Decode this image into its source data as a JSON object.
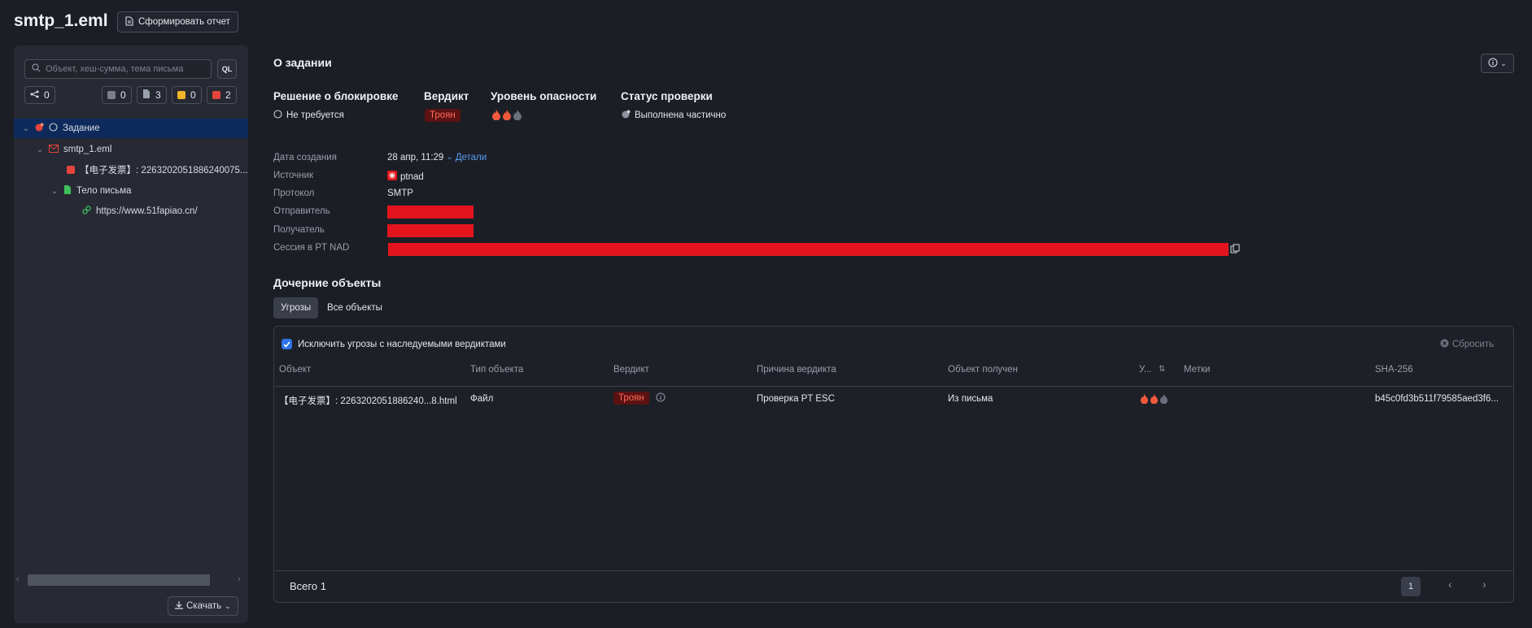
{
  "header": {
    "title": "smtp_1.eml",
    "report_button": "Сформировать отчет"
  },
  "sidebar": {
    "search_placeholder": "Объект, хеш-сумма, тема письма",
    "ql_label": "QL",
    "chips": [
      {
        "icon": "share-icon",
        "count": "0"
      },
      {
        "icon": "gray-square",
        "color": "#7a7f8c",
        "count": "0"
      },
      {
        "icon": "file-icon",
        "count": "3"
      },
      {
        "icon": "yellow-square",
        "color": "#f0b429",
        "count": "0"
      },
      {
        "icon": "red-square",
        "color": "#e5453b",
        "count": "2"
      }
    ],
    "tree": [
      {
        "label": "Задание",
        "level": 0
      },
      {
        "label": "smtp_1.eml",
        "level": 1
      },
      {
        "label": "【电子发票】: 2263202051886240075...",
        "level": 2
      },
      {
        "label": "Тело письма",
        "level": 2
      },
      {
        "label": "https://www.51fapiao.cn/",
        "level": 3
      }
    ],
    "download_button": "Скачать"
  },
  "task": {
    "title": "О задании",
    "blocking": {
      "heading": "Решение о блокировке",
      "value": "Не требуется"
    },
    "verdict": {
      "heading": "Вердикт",
      "value": "Троян"
    },
    "danger": {
      "heading": "Уровень опасности",
      "level": 2,
      "max": 3
    },
    "status": {
      "heading": "Статус проверки",
      "value": "Выполнена частично"
    },
    "details": [
      {
        "label": "Дата создания",
        "value": "28 апр, 11:29",
        "link": "Детали"
      },
      {
        "label": "Источник",
        "value": "ptnad"
      },
      {
        "label": "Протокол",
        "value": "SMTP"
      },
      {
        "label": "Отправитель",
        "value": ""
      },
      {
        "label": "Получатель",
        "value": ""
      },
      {
        "label": "Сессия в PT NAD",
        "value": ""
      }
    ]
  },
  "children": {
    "title": "Дочерние объекты",
    "tabs": [
      "Угрозы",
      "Все объекты"
    ],
    "exclude_label": "Исключить угрозы с наследуемыми вердиктами",
    "reset_label": "Сбросить",
    "columns": [
      "Объект",
      "Тип объекта",
      "Вердикт",
      "Причина вердикта",
      "Объект получен",
      "У...",
      "Метки",
      "SHA-256"
    ],
    "rows": [
      {
        "object": "【电子发票】: 2263202051886240...8.html",
        "type": "Файл",
        "verdict": "Троян",
        "reason": "Проверка PT ESC",
        "received": "Из письма",
        "danger_level": 2,
        "tags": "",
        "sha256": "b45c0fd3b511f79585aed3f6..."
      }
    ],
    "total_label": "Всего 1",
    "page": "1"
  },
  "colors": {
    "accent": "#2e73e8",
    "danger": "#e3141d",
    "verdict_bg": "#5c1212"
  }
}
